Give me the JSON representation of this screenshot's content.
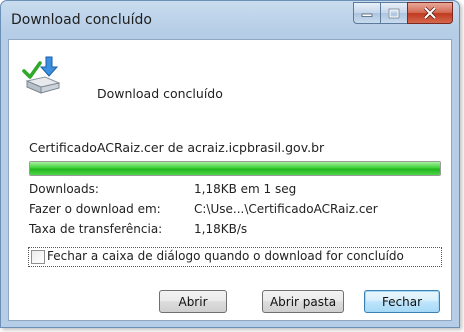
{
  "window": {
    "title": "Download concluído"
  },
  "header": {
    "text": "Download concluído",
    "icon": "download-complete-icon"
  },
  "download": {
    "filename_line": "CertificadoACRaiz.cer de acraiz.icpbrasil.gov.br",
    "progress_percent": 100
  },
  "info": [
    {
      "label": "Downloads:",
      "value": "1,18KB em 1 seg"
    },
    {
      "label": "Fazer o download em:",
      "value": "C:\\Use...\\CertificadoACRaiz.cer"
    },
    {
      "label": "Taxa de transferência:",
      "value": "1,18KB/s"
    }
  ],
  "checkbox": {
    "label": "Fechar a caixa de diálogo quando o download for concluído",
    "checked": false
  },
  "buttons": {
    "open": "Abrir",
    "open_folder": "Abrir pasta",
    "close": "Fechar"
  },
  "colors": {
    "progress_green": "#22b520",
    "close_button_red": "#c0391f"
  }
}
